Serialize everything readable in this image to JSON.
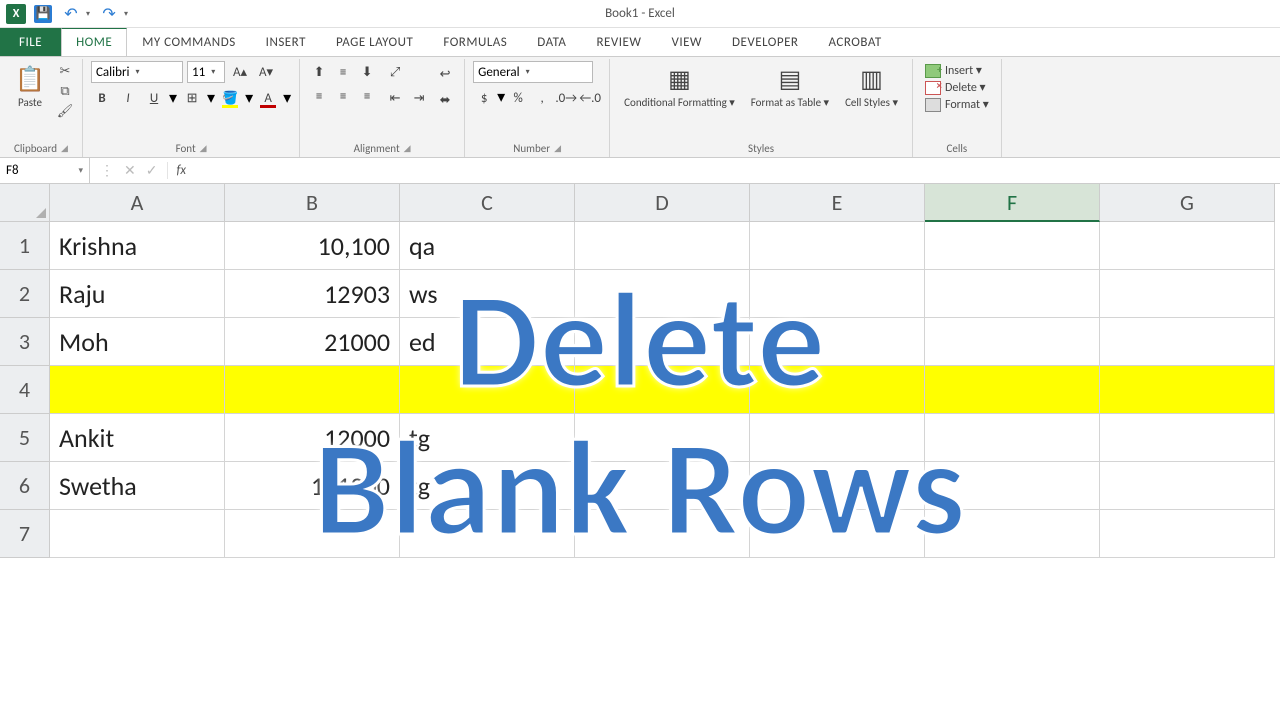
{
  "title": "Book1 - Excel",
  "qat": {
    "excel_char": "X▮",
    "save_char": "💾"
  },
  "tabs": [
    "FILE",
    "HOME",
    "MY COMMANDS",
    "INSERT",
    "PAGE LAYOUT",
    "FORMULAS",
    "DATA",
    "REVIEW",
    "VIEW",
    "DEVELOPER",
    "ACROBAT"
  ],
  "active_tab": "HOME",
  "ribbon": {
    "clipboard": {
      "paste": "Paste",
      "label": "Clipboard"
    },
    "font": {
      "name": "Calibri",
      "size": "11",
      "label": "Font"
    },
    "alignment": {
      "label": "Alignment"
    },
    "number": {
      "format": "General",
      "label": "Number"
    },
    "styles": {
      "cond_fmt": "Conditional Formatting ▾",
      "fmt_table": "Format as Table ▾",
      "cell_styles": "Cell Styles ▾",
      "label": "Styles"
    },
    "cells": {
      "insert": "Insert ▾",
      "delete": "Delete ▾",
      "format": "Format ▾",
      "label": "Cells"
    }
  },
  "namebox": "F8",
  "columns": [
    "A",
    "B",
    "C",
    "D",
    "E",
    "F",
    "G"
  ],
  "active_column_index": 5,
  "rows": [
    {
      "n": "1",
      "a": "Krishna",
      "b": "10,100",
      "c": "qa"
    },
    {
      "n": "2",
      "a": "Raju",
      "b": "12903",
      "c": "ws"
    },
    {
      "n": "3",
      "a": "Moh",
      "b": "21000",
      "c": "ed"
    },
    {
      "n": "4",
      "a": "",
      "b": "",
      "c": "",
      "highlight": true
    },
    {
      "n": "5",
      "a": "Ankit",
      "b": "12000",
      "c": "tg"
    },
    {
      "n": "6",
      "a": "Swetha",
      "b": "111200",
      "c": "tg"
    },
    {
      "n": "7",
      "a": "",
      "b": "",
      "c": ""
    }
  ],
  "overlay": {
    "line1": "Delete",
    "line2": "Blank Rows"
  }
}
